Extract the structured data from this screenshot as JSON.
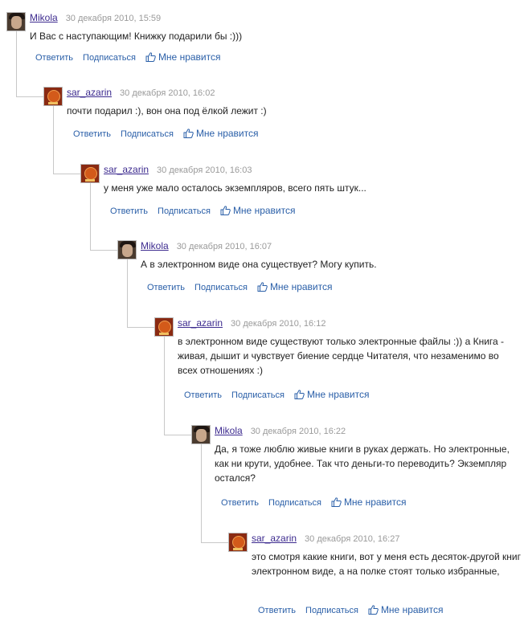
{
  "comments": [
    {
      "author": "Mikola",
      "date": "30 декабря 2010, 15:59",
      "avatar": "mikola-avatar",
      "lines": [
        "И Вас с наступающим! Книжку подарили бы :)))"
      ],
      "actions": {
        "reply": "Ответить",
        "subscribe": "Подписаться",
        "like": "Мне нравится"
      }
    },
    {
      "author": "sar_azarin",
      "date": "30 декабря 2010, 16:02",
      "avatar": "sar-azarin-avatar",
      "lines": [
        "почти подарил :), вон она под ёлкой лежит :)"
      ],
      "actions": {
        "reply": "Ответить",
        "subscribe": "Подписаться",
        "like": "Мне нравится"
      }
    },
    {
      "author": "sar_azarin",
      "date": "30 декабря 2010, 16:03",
      "avatar": "sar-azarin-avatar",
      "lines": [
        "у меня уже мало осталось экземпляров, всего пять штук..."
      ],
      "actions": {
        "reply": "Ответить",
        "subscribe": "Подписаться",
        "like": "Мне нравится"
      }
    },
    {
      "author": "Mikola",
      "date": "30 декабря 2010, 16:07",
      "avatar": "mikola-avatar",
      "lines": [
        "А в электронном виде она существует? Могу купить."
      ],
      "actions": {
        "reply": "Ответить",
        "subscribe": "Подписаться",
        "like": "Мне нравится"
      }
    },
    {
      "author": "sar_azarin",
      "date": "30 декабря 2010, 16:12",
      "avatar": "sar-azarin-avatar",
      "lines": [
        "в электронном виде существуют только электронные файлы :)) а Книга -",
        "живая, дышит и чувствует биение сердце Читателя, что незаменимо во",
        "всех отношениях :)"
      ],
      "actions": {
        "reply": "Ответить",
        "subscribe": "Подписаться",
        "like": "Мне нравится"
      }
    },
    {
      "author": "Mikola",
      "date": "30 декабря 2010, 16:22",
      "avatar": "mikola-avatar",
      "lines": [
        "Да, я тоже люблю живые книги в руках держать. Но электронные,",
        "как ни крути, удобнее. Так что деньги-то переводить? Экземпляр",
        "остался?"
      ],
      "actions": {
        "reply": "Ответить",
        "subscribe": "Подписаться",
        "like": "Мне нравится"
      }
    },
    {
      "author": "sar_azarin",
      "date": "30 декабря 2010, 16:27",
      "avatar": "sar-azarin-avatar",
      "lines": [
        "это смотря какие книги, вот у меня есть десяток-другой книг в",
        "электронном виде, а на полке стоят только избранные,"
      ],
      "actions": {
        "reply": "Ответить",
        "subscribe": "Подписаться",
        "like": "Мне нравится"
      }
    }
  ]
}
